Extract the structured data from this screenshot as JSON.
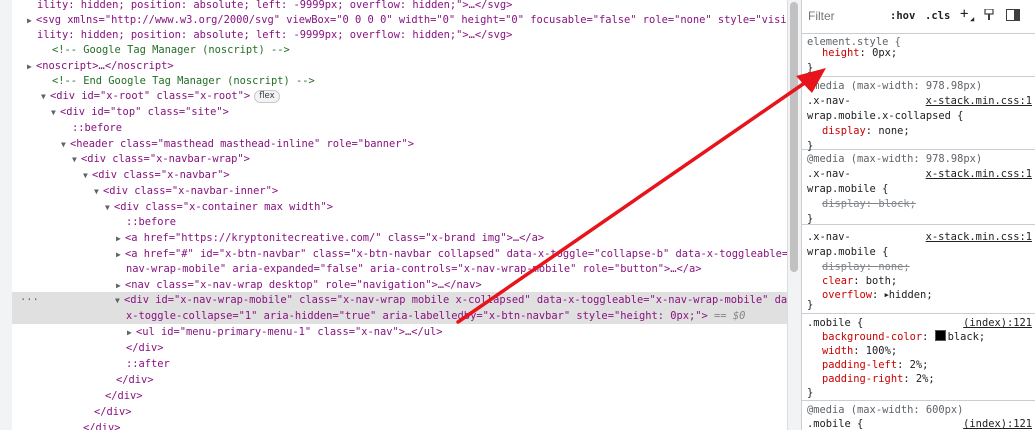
{
  "dom_lines": [
    "ility: hidden; position: absolute; left: -9999px; overflow: hidden;\">…</svg>",
    "<svg xmlns=\"http://www.w3.org/2000/svg\" viewBox=\"0 0 0 0\" width=\"0\" height=\"0\" focusable=\"false\" role=\"none\" style=\"visib",
    "ility: hidden; position: absolute; left: -9999px; overflow: hidden;\">…</svg>",
    "<!-- Google Tag Manager (noscript) -->",
    "<noscript>…</noscript>",
    "<!-- End Google Tag Manager (noscript) -->",
    "<div id=\"x-root\" class=\"x-root\">",
    "<div id=\"top\" class=\"site\">",
    "::before",
    "<header class=\"masthead masthead-inline\" role=\"banner\">",
    "<div class=\"x-navbar-wrap\">",
    "<div class=\"x-navbar\">",
    "<div class=\"x-navbar-inner\">",
    "<div class=\"x-container max width\">",
    "::before",
    "<a href=\"https://kryptonitecreative.com/\" class=\"x-brand img\">…</a>",
    "<a href=\"#\" id=\"x-btn-navbar\" class=\"x-btn-navbar collapsed\" data-x-toggle=\"collapse-b\" data-x-toggleable=\"x-",
    "nav-wrap-mobile\" aria-expanded=\"false\" aria-controls=\"x-nav-wrap-mobile\" role=\"button\">…</a>",
    "<nav class=\"x-nav-wrap desktop\" role=\"navigation\">…</nav>",
    "<div id=\"x-nav-wrap-mobile\" class=\"x-nav-wrap mobile x-collapsed\" data-x-toggleable=\"x-nav-wrap-mobile\" data-",
    "x-toggle-collapse=\"1\" aria-hidden=\"true\" aria-labelledby=\"x-btn-navbar\" style=\"height: 0px;\">",
    "<ul id=\"menu-primary-menu-1\" class=\"x-nav\">…</ul>",
    "</div>",
    "::after",
    "</div>",
    "</div>",
    "</div>",
    "</div>"
  ],
  "flex_badge": "flex",
  "selected_marker": "== $0",
  "more_dots": "···",
  "styles_toolbar": {
    "filter_placeholder": "Filter",
    "hov": ":hov",
    "cls": ".cls",
    "plus": "+",
    "computed_icon": "paint-icon",
    "sidebar_icon": "sidebar-icon"
  },
  "rules": [
    {
      "selector": "element.style {",
      "props": [
        {
          "name": "height",
          "value": "0px;"
        }
      ],
      "close": "}"
    },
    {
      "media": "@media (max-width: 978.98px)",
      "selector_lines": [
        ".x-nav-",
        "wrap.mobile.x-collapsed {"
      ],
      "source": "x-stack.min.css:1",
      "props": [
        {
          "name": "display",
          "value": "none;"
        }
      ],
      "close": "}"
    },
    {
      "media": "@media (max-width: 978.98px)",
      "selector_lines": [
        ".x-nav-",
        "wrap.mobile {"
      ],
      "source": "x-stack.min.css:1",
      "props": [
        {
          "name": "display",
          "value": "block;",
          "struck": true
        }
      ],
      "close": "}"
    },
    {
      "selector_lines": [
        ".x-nav-",
        "wrap.mobile {"
      ],
      "source": "x-stack.min.css:1",
      "props": [
        {
          "name": "display",
          "value": "none;",
          "struck": true
        },
        {
          "name": "clear",
          "value": "both;"
        },
        {
          "name": "overflow",
          "value": "hidden;"
        }
      ],
      "close": "}"
    },
    {
      "selector_lines": [
        ".mobile {"
      ],
      "source": "(index):121",
      "props": [
        {
          "name": "background-color",
          "value": "black;"
        },
        {
          "name": "width",
          "value": "100%;"
        },
        {
          "name": "padding-left",
          "value": "2%;"
        },
        {
          "name": "padding-right",
          "value": "2%;"
        }
      ],
      "close": "}"
    },
    {
      "media": "@media (max-width: 600px)",
      "selector_lines": [
        ".mobile {"
      ],
      "source": "(index):121"
    }
  ],
  "annotation_color": "#e8141b"
}
